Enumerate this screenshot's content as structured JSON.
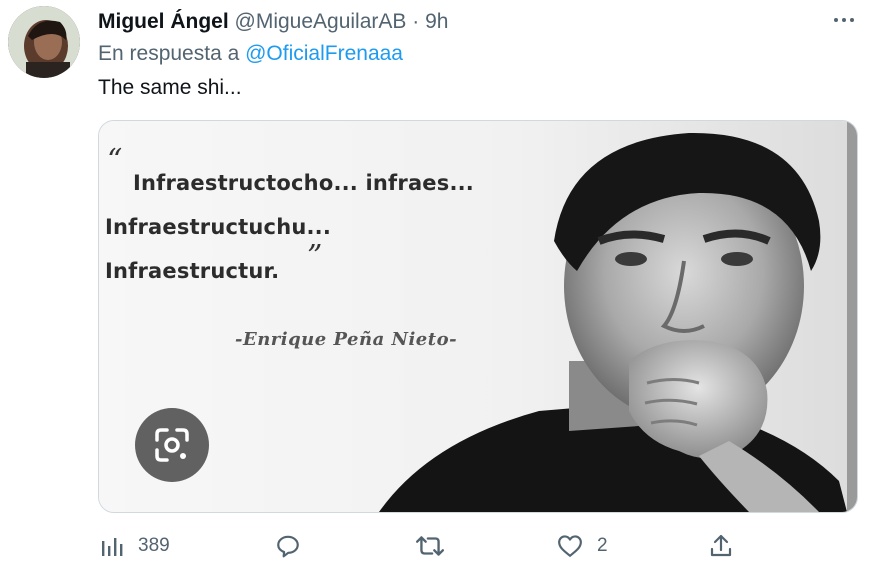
{
  "tweet": {
    "author_name": "Miguel Ángel",
    "handle": "@MigueAguilarAB",
    "separator": "·",
    "time": "9h",
    "reply_prefix": "En respuesta a",
    "reply_to": "@OficialFrenaaa",
    "text": "The same shi..."
  },
  "media": {
    "quote_lines": [
      "Infraestructocho... infraes...",
      "Infraestructuchu...",
      "Infraestructur."
    ],
    "open_quote": "“",
    "close_quote": "”",
    "signature": "-Enrique Peña Nieto-",
    "lens_icon": "google-lens-icon"
  },
  "actions": {
    "views_count": "389",
    "likes_count": "2",
    "icons": [
      "analytics-icon",
      "reply-icon",
      "retweet-icon",
      "like-icon",
      "share-icon"
    ]
  },
  "colors": {
    "link": "#1d9bf0",
    "secondary_text": "#536471",
    "primary_text": "#0f1419"
  }
}
